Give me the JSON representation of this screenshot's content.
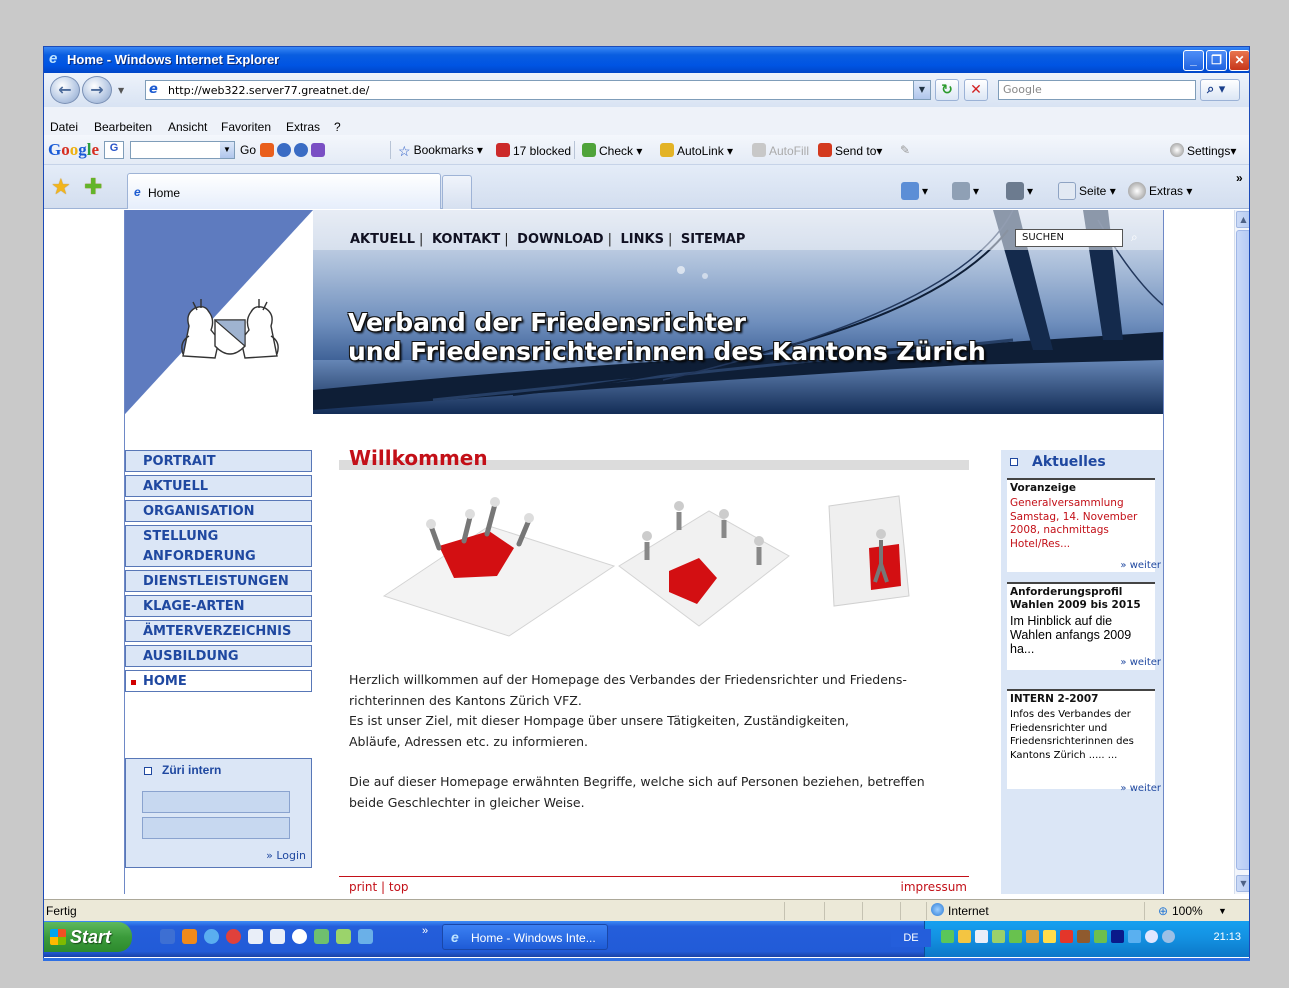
{
  "window": {
    "title": "Home - Windows Internet Explorer",
    "controls": {
      "minimize": "_",
      "maximize": "❐",
      "close": "✕"
    }
  },
  "address_bar": {
    "url": "http://web322.server77.greatnet.de/",
    "search_placeholder": "Google"
  },
  "menu": [
    "Datei",
    "Bearbeiten",
    "Ansicht",
    "Favoriten",
    "Extras",
    "?"
  ],
  "google_toolbar": {
    "logo": "Google",
    "engine": "G",
    "go": "Go",
    "bookmarks": "Bookmarks",
    "blocked": "17 blocked",
    "check": "Check",
    "autolink": "AutoLink",
    "autofill": "AutoFill",
    "send_to": "Send to",
    "settings": "Settings"
  },
  "tab": {
    "label": "Home"
  },
  "command_bar": {
    "page": "Seite",
    "tools": "Extras",
    "overflow": "»"
  },
  "page": {
    "top_nav": [
      "AKTUELL",
      "KONTAKT",
      "DOWNLOAD",
      "LINKS",
      "SITEMAP"
    ],
    "search_label": "SUCHEN",
    "heading_line1": "Verband der Friedensrichter",
    "heading_line2": "und Friedensrichterinnen des Kantons Zürich",
    "left_nav": [
      {
        "label": "PORTRAIT"
      },
      {
        "label": "AKTUELL"
      },
      {
        "label": "ORGANISATION"
      },
      {
        "label": "STELLUNG"
      },
      {
        "label": "ANFORDERUNG"
      },
      {
        "label": "DIENSTLEISTUNGEN"
      },
      {
        "label": "KLAGE-ARTEN"
      },
      {
        "label": "ÄMTERVERZEICHNIS"
      },
      {
        "label": "AUSBILDUNG"
      },
      {
        "label": "HOME"
      }
    ],
    "login_box": {
      "title": "Züri intern",
      "login": "» Login"
    },
    "welcome_title": "Willkommen",
    "intro_p1_l1": "Herzlich willkommen auf der Homepage des Verbandes der Friedensrichter und Friedens-",
    "intro_p1_l2": "richterinnen des Kantons Zürich VFZ.",
    "intro_p1_l3": "Es ist unser Ziel, mit dieser Hompage über unsere Tätigkeiten, Zuständigkeiten,",
    "intro_p1_l4": "Abläufe, Adressen etc. zu informieren.",
    "intro_p2_l1": "Die auf dieser Homepage erwähnten Begriffe, welche sich auf Personen beziehen, betreffen",
    "intro_p2_l2": "beide Geschlechter in gleicher Weise.",
    "footer_left": "print | top",
    "footer_right": "impressum",
    "aktuelles": {
      "title": "Aktuelles",
      "items": [
        {
          "heading": "Voranzeige",
          "body": "Generalversammlung Samstag, 14. November 2008, nachmittags Hotel/Res...",
          "more": "» weiter"
        },
        {
          "heading": "Anforderungsprofil Wahlen 2009 bis 2015",
          "body": "Im Hinblick auf die Wahlen anfangs 2009 ha...",
          "more": "» weiter"
        },
        {
          "heading": "INTERN 2-2007",
          "body": "Infos des Verbandes der Friedensrichter und Friedensrichterinnen des Kantons Zürich ..... ...",
          "more": "» weiter"
        }
      ]
    }
  },
  "status_bar": {
    "status": "Fertig",
    "zone": "Internet",
    "zoom": "100%"
  },
  "taskbar": {
    "start": "Start",
    "task": "Home - Windows Inte...",
    "language": "DE",
    "clock": "21:13"
  },
  "colors": {
    "accent_red": "#c31018",
    "nav_blue": "#1f48a0",
    "nav_bg": "#dbe6f6"
  }
}
